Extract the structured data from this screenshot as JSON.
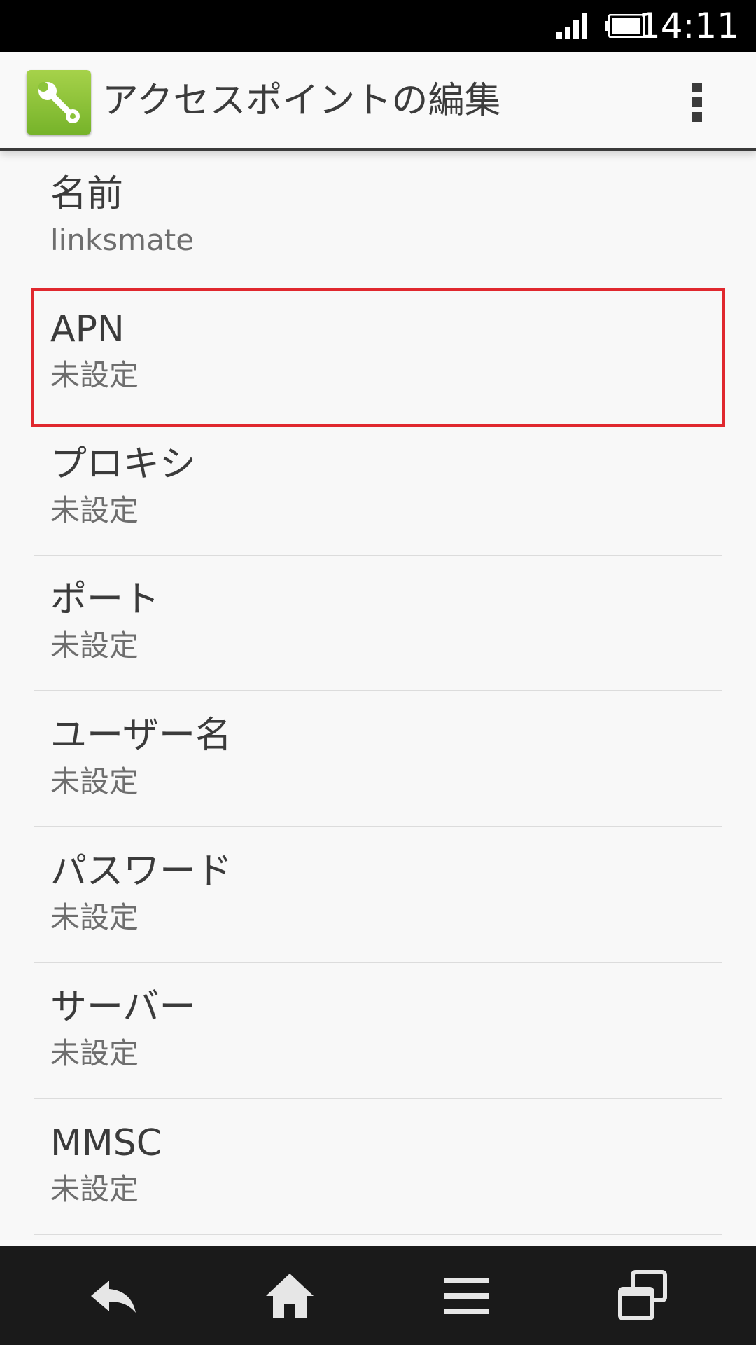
{
  "status_bar": {
    "time": "14:11",
    "icons": [
      "signal-icon",
      "battery-icon"
    ]
  },
  "action_bar": {
    "app_icon": "wrench-icon",
    "title": "アクセスポイントの編集",
    "overflow_icon": "overflow-menu-icon"
  },
  "settings": {
    "items": [
      {
        "label": "名前",
        "value": "linksmate"
      },
      {
        "label": "APN",
        "value": "未設定"
      },
      {
        "label": "プロキシ",
        "value": "未設定"
      },
      {
        "label": "ポート",
        "value": "未設定"
      },
      {
        "label": "ユーザー名",
        "value": "未設定"
      },
      {
        "label": "パスワード",
        "value": "未設定"
      },
      {
        "label": "サーバー",
        "value": "未設定"
      },
      {
        "label": "MMSC",
        "value": "未設定"
      }
    ],
    "highlight_color": "#e0282e"
  },
  "nav_bar": {
    "buttons": [
      "back-icon",
      "home-icon",
      "menu-icon",
      "recent-apps-icon"
    ]
  }
}
